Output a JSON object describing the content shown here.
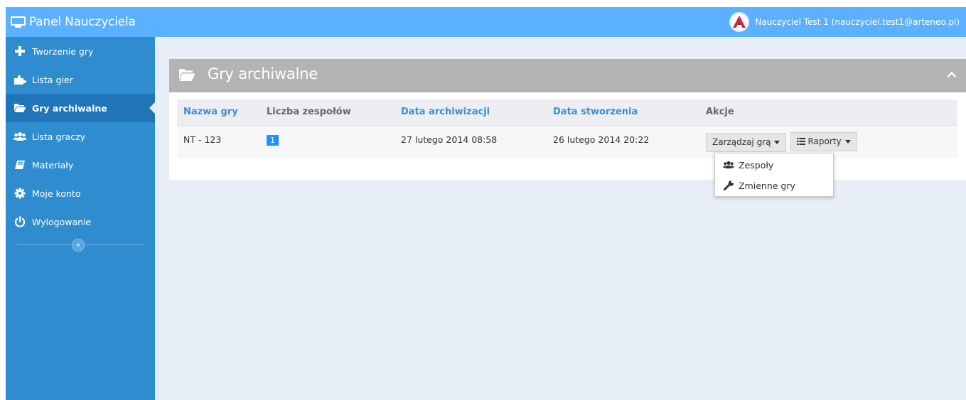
{
  "app": {
    "title": "Panel Nauczyciela"
  },
  "user": {
    "display": "Nauczyciel Test 1 (nauczyciel.test1@arteneo.pl)"
  },
  "sidebar": {
    "items": [
      {
        "label": "Tworzenie gry",
        "icon": "plus-icon"
      },
      {
        "label": "Lista gier",
        "icon": "puzzle-icon"
      },
      {
        "label": "Gry archiwalne",
        "icon": "folder-open-icon",
        "active": true
      },
      {
        "label": "Lista graczy",
        "icon": "users-icon"
      },
      {
        "label": "Materiały",
        "icon": "book-icon"
      },
      {
        "label": "Moje konto",
        "icon": "gear-icon"
      },
      {
        "label": "Wylogowanie",
        "icon": "power-icon"
      }
    ],
    "collapse_label": "«"
  },
  "panel": {
    "title": "Gry archiwalne",
    "columns": [
      "Nazwa gry",
      "Liczba zespołów",
      "Data archiwizacji",
      "Data stworzenia",
      "Akcje"
    ],
    "rows": [
      {
        "name": "NT - 123",
        "teams": "1",
        "archived": "27 lutego 2014 08:58",
        "created": "26 lutego 2014 20:22",
        "manage_label": "Zarządzaj grą",
        "reports_label": "Raporty"
      }
    ]
  },
  "dropdown": {
    "items": [
      {
        "label": "Zespoły",
        "icon": "users-icon"
      },
      {
        "label": "Zmienne gry",
        "icon": "wrench-icon"
      }
    ]
  },
  "colors": {
    "navbar": "#5bb0ff",
    "sidebar": "#2f8dcf",
    "sidebar_active": "#1f75b8",
    "panel_header": "#b3b3b3",
    "link": "#3b8fd6",
    "badge": "#1e90ff"
  }
}
